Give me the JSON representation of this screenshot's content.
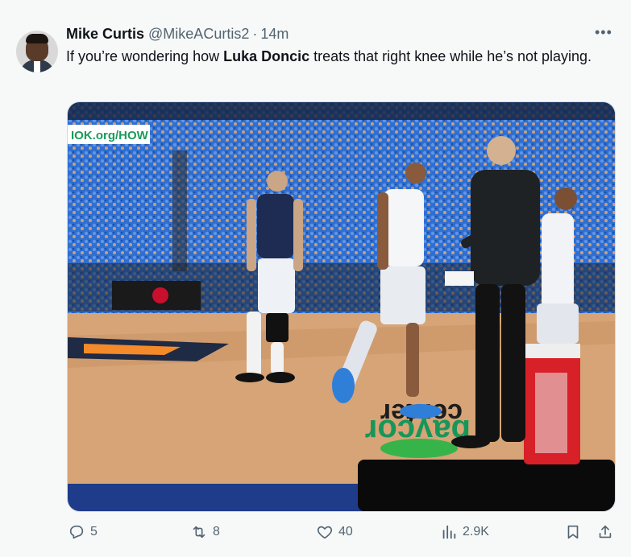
{
  "tweet": {
    "author_name": "Mike Curtis",
    "handle": "@MikeACurtis2",
    "separator": "·",
    "time": "14m",
    "more_label": "•••",
    "text_before": "If you’re wondering how ",
    "text_bold": "Luka Doncic",
    "text_after": " treats that right knee while he’s not playing.",
    "media": {
      "banner_text": "IOK.org/HOW",
      "court_text_1": "center",
      "court_text_2": "baycor"
    }
  },
  "actions": {
    "replies": "5",
    "reposts": "8",
    "likes": "40",
    "views": "2.9K"
  },
  "colors": {
    "accent": "#1d9bf0",
    "muted": "#536471",
    "crowd_blue": "#2f6fd1",
    "court": "#d6a476"
  }
}
